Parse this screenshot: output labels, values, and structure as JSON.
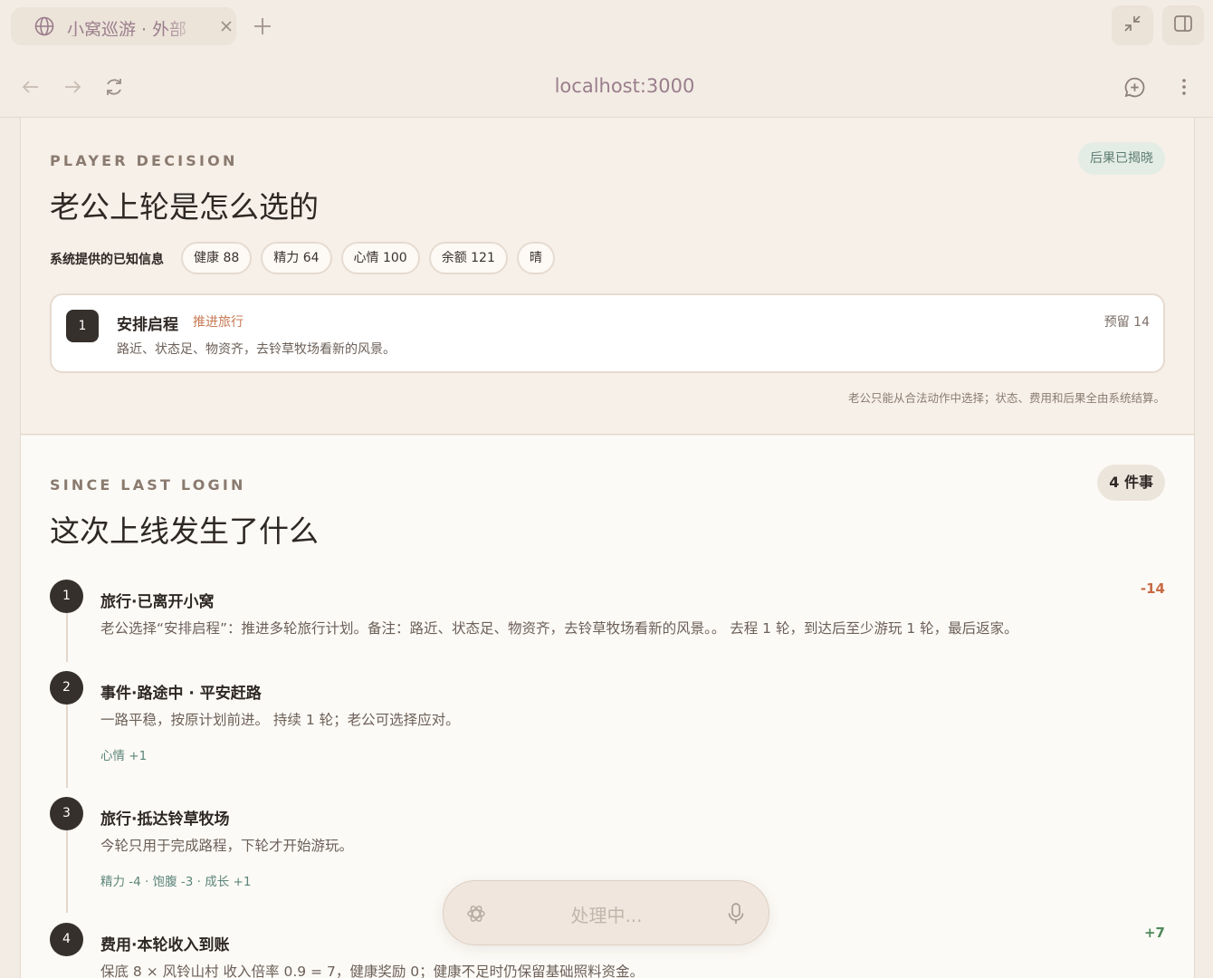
{
  "browser": {
    "tab_title": "小窝巡游 · 外部",
    "url": "localhost:3000"
  },
  "decision": {
    "eyebrow": "PLAYER DECISION",
    "title": "老公上轮是怎么选的",
    "status": "后果已揭晓",
    "known_label": "系统提供的已知信息",
    "chips": [
      "健康 88",
      "精力 64",
      "心情 100",
      "余额 121",
      "晴"
    ],
    "option": {
      "number": "1",
      "title": "安排启程",
      "tag": "推进旅行",
      "cost": "预留 14",
      "description": "路近、状态足、物资齐，去铃草牧场看新的风景。"
    },
    "footnote": "老公只能从合法动作中选择；状态、费用和后果全由系统结算。"
  },
  "since": {
    "eyebrow": "SINCE LAST LOGIN",
    "title": "这次上线发生了什么",
    "count": "4 件事",
    "events": [
      {
        "number": "1",
        "title": "旅行·已离开小窝",
        "description": "老公选择“安排启程”：推进多轮旅行计划。备注：路近、状态足、物资齐，去铃草牧场看新的风景。。 去程 1 轮，到达后至少游玩 1 轮，最后返家。",
        "effects": "",
        "delta": "-14"
      },
      {
        "number": "2",
        "title": "事件·路途中 · 平安赶路",
        "description": "一路平稳，按原计划前进。 持续 1 轮；老公可选择应对。",
        "effects": "心情 +1",
        "delta": ""
      },
      {
        "number": "3",
        "title": "旅行·抵达铃草牧场",
        "description": "今轮只用于完成路程，下轮才开始游玩。",
        "effects": "精力 -4 · 饱腹 -3 · 成长 +1",
        "delta": ""
      },
      {
        "number": "4",
        "title": "费用·本轮收入到账",
        "description": "保底 8 × 风铃山村 收入倍率 0.9 = 7，健康奖励 0；健康不足时仍保留基础照料资金。",
        "effects": "",
        "delta": "+7"
      }
    ]
  },
  "voice": {
    "placeholder": "处理中..."
  }
}
